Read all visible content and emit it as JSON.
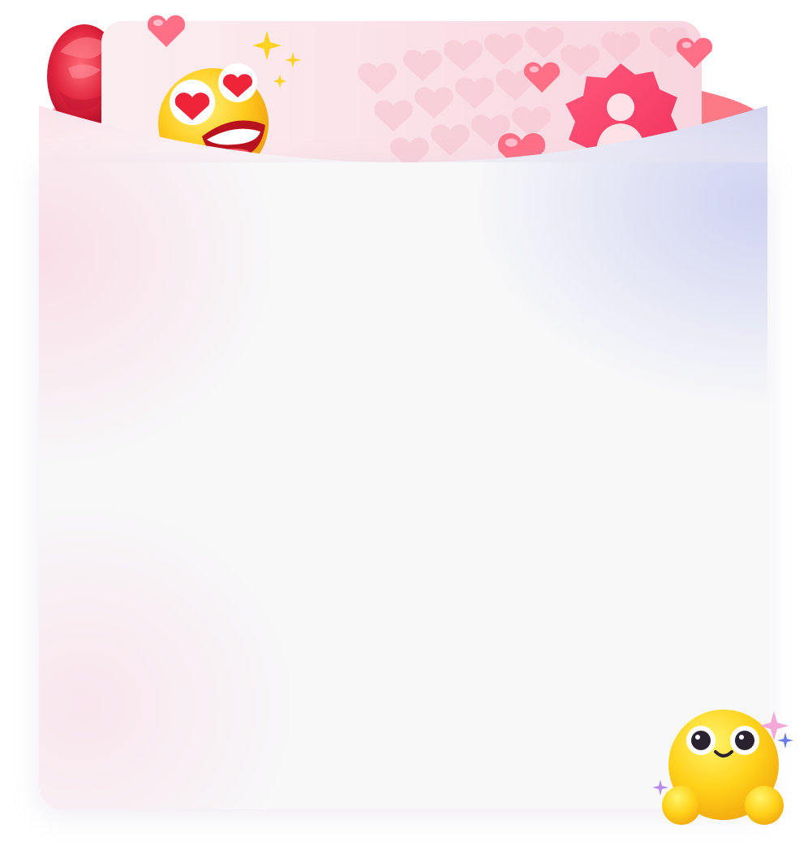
{
  "scene": {
    "decorations": [
      "rose-icon",
      "heart-eyes-emoji",
      "sparkle-icon",
      "floating-heart-icon",
      "profile-badge-icon",
      "smiling-mascot",
      "background-hearts-pattern"
    ]
  },
  "colors": {
    "rim_pink": "#fa7d89",
    "badge_pink": "#f7416b",
    "emoji_yellow": "#ffd21f",
    "heart_red": "#ff4a5c",
    "panel_bg": "#f8f8f9",
    "lavender_glow": "#c8ccf0"
  }
}
